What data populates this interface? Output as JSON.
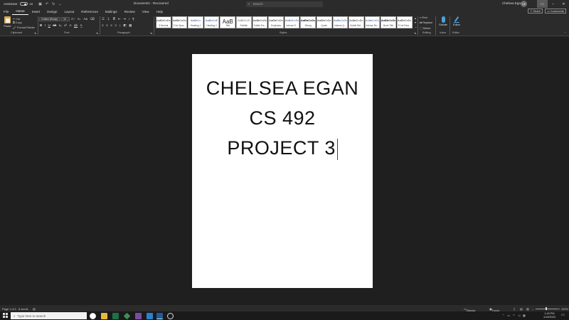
{
  "titlebar": {
    "autosave": "AutoSave",
    "autosave_state": "Off",
    "doc_title": "Document1 - Recovered",
    "search_placeholder": "Search",
    "user_name": "Chelsea Egan",
    "user_initials": "CE"
  },
  "tabs": [
    "File",
    "Home",
    "Insert",
    "Design",
    "Layout",
    "References",
    "Mailings",
    "Review",
    "View",
    "Help"
  ],
  "active_tab": "Home",
  "actions": {
    "share": "Share",
    "comments": "Comments"
  },
  "ribbon": {
    "paste": "Paste",
    "cut": "Cut",
    "copy": "Copy",
    "format_painter": "Format Painter",
    "font_name": "Calibri (Body)",
    "font_size": "11",
    "find": "Find",
    "replace": "Replace",
    "select": "Select",
    "dictate": "Dictate",
    "editor": "Editor",
    "groups": {
      "clipboard": "Clipboard",
      "font": "Font",
      "paragraph": "Paragraph",
      "styles": "Styles",
      "editing": "Editing",
      "voice": "Voice",
      "editor": "Editor"
    },
    "styles": [
      {
        "preview": "AaBbCcDc",
        "name": "¶ Normal"
      },
      {
        "preview": "AaBbCcDc",
        "name": "¶ No Spac..."
      },
      {
        "preview": "AaBbCc",
        "name": "Heading 1"
      },
      {
        "preview": "AaBbCcE",
        "name": "Heading 2"
      },
      {
        "preview": "AaB",
        "name": "Title"
      },
      {
        "preview": "AaBbCcD",
        "name": "Subtitle"
      },
      {
        "preview": "AaBbCcDc",
        "name": "Subtle Em..."
      },
      {
        "preview": "AaBbCcDc",
        "name": "Emphasis"
      },
      {
        "preview": "AaBbCcDc",
        "name": "Intense E..."
      },
      {
        "preview": "AaBbCcDc",
        "name": "Strong"
      },
      {
        "preview": "AaBbCcDc",
        "name": "Quote"
      },
      {
        "preview": "AaBbCcDc",
        "name": "Intense Q..."
      },
      {
        "preview": "AaBbCcDc",
        "name": "Subtle Ref..."
      },
      {
        "preview": "AaBbCcDc",
        "name": "Intense Re..."
      },
      {
        "preview": "AaBbCcDc",
        "name": "Book Title"
      },
      {
        "preview": "AaBbCcDc",
        "name": "¶ List Para..."
      }
    ]
  },
  "document": {
    "lines": [
      "CHELSEA EGAN",
      "CS 492",
      "PROJECT 3"
    ]
  },
  "status": {
    "page": "Page 1 of 1",
    "words": "6 words",
    "display_settings": "Display Settings",
    "focus": "Focus",
    "zoom": "100%"
  },
  "taskbar": {
    "search_placeholder": "Type here to search",
    "time": "1:18 PM",
    "date": "1/19/2020"
  }
}
